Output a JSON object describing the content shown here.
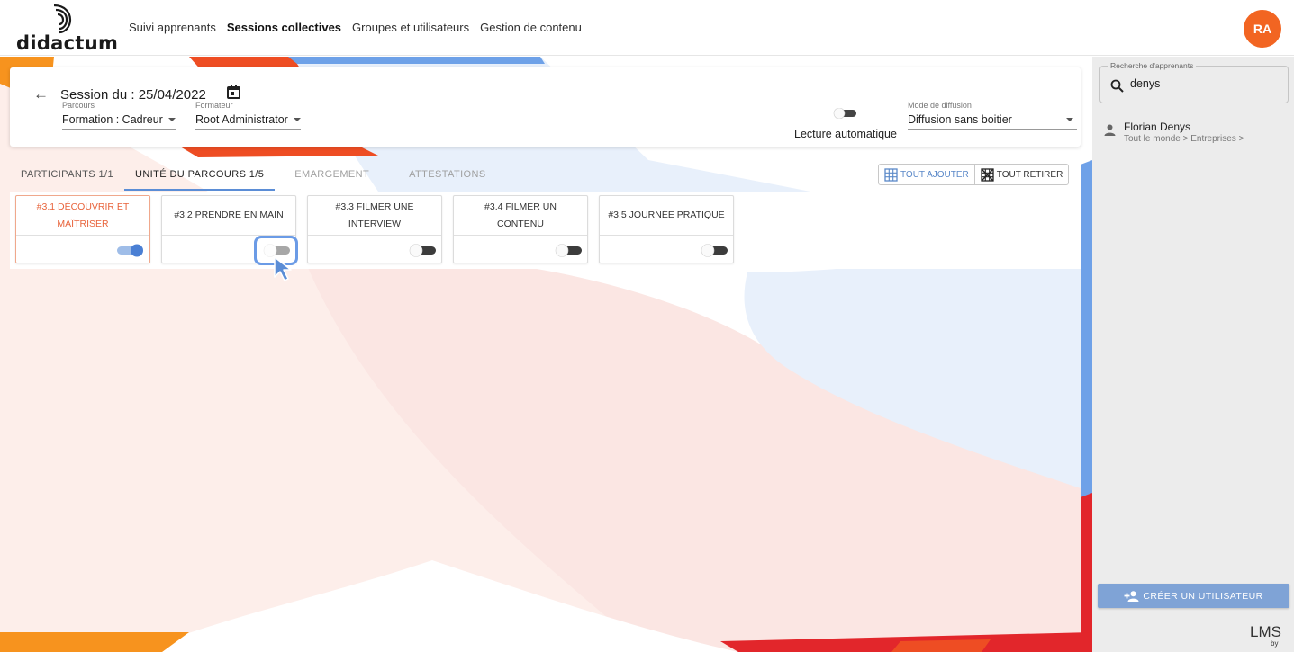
{
  "brand": {
    "logo_text": "didactum"
  },
  "nav": {
    "items": [
      {
        "label": "Suivi apprenants",
        "active": false
      },
      {
        "label": "Sessions collectives",
        "active": true
      },
      {
        "label": "Groupes et utilisateurs",
        "active": false
      },
      {
        "label": "Gestion de contenu",
        "active": false
      }
    ]
  },
  "user": {
    "initials": "RA",
    "avatar_color": "#f26522"
  },
  "session": {
    "title": "Session du : 25/04/2022",
    "parcours_label": "Parcours",
    "parcours_value": "Formation : Cadreur",
    "formateur_label": "Formateur",
    "formateur_value": "Root Administrator",
    "auto_play_label": "Lecture automatique",
    "auto_play_on": false,
    "mode_label": "Mode de diffusion",
    "mode_value": "Diffusion sans boitier"
  },
  "tabs": [
    {
      "label": "PARTICIPANTS 1/1",
      "state": "normal"
    },
    {
      "label": "UNITÉ DU PARCOURS 1/5",
      "state": "active"
    },
    {
      "label": "EMARGEMENT",
      "state": "disabled"
    },
    {
      "label": "ATTESTATIONS",
      "state": "disabled"
    }
  ],
  "toolbar": {
    "add_all": "TOUT AJOUTER",
    "remove_all": "TOUT RETIRER"
  },
  "units": [
    {
      "title": "#3.1 DÉCOUVRIR ET MAÎTRISER",
      "enabled": true
    },
    {
      "title": "#3.2 PRENDRE EN MAIN",
      "enabled": false
    },
    {
      "title": "#3.3 FILMER UNE INTERVIEW",
      "enabled": false
    },
    {
      "title": "#3.4 FILMER UN CONTENU",
      "enabled": false
    },
    {
      "title": "#3.5 JOURNÉE PRATIQUE",
      "enabled": false
    }
  ],
  "sidebar": {
    "search_label": "Recherche d'apprenants",
    "search_value": "denys",
    "results": [
      {
        "name": "Florian Denys",
        "path": "Tout le monde > Entreprises >"
      }
    ],
    "create_button": "CRÉER UN UTILISATEUR",
    "footer_brand": "LMS",
    "footer_by": "by"
  },
  "colors": {
    "accent_orange": "#f26522",
    "accent_blue": "#5b8dd6",
    "toggle_on": "#4a7fd4",
    "create_button": "#7fa3d6"
  }
}
